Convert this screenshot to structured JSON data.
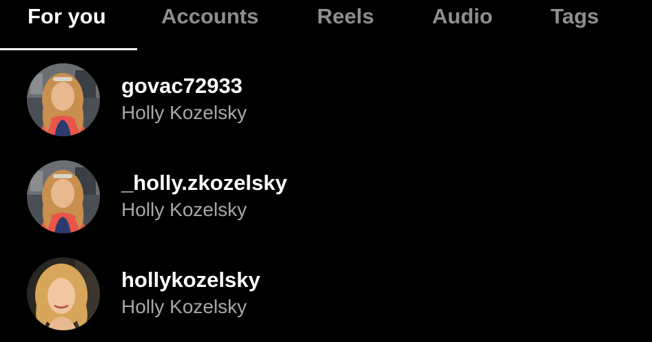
{
  "tabs": [
    {
      "label": "For you",
      "active": true
    },
    {
      "label": "Accounts",
      "active": false
    },
    {
      "label": "Reels",
      "active": false
    },
    {
      "label": "Audio",
      "active": false
    },
    {
      "label": "Tags",
      "active": false
    }
  ],
  "results": [
    {
      "username": "govac72933",
      "full_name": "Holly Kozelsky",
      "avatar": "profile-photo-woman-sunglasses"
    },
    {
      "username": "_holly.zkozelsky",
      "full_name": "Holly Kozelsky",
      "avatar": "profile-photo-woman-sunglasses"
    },
    {
      "username": "hollykozelsky",
      "full_name": "Holly Kozelsky",
      "avatar": "profile-photo-woman-portrait"
    }
  ],
  "colors": {
    "background": "#000000",
    "active_tab": "#ffffff",
    "inactive_tab": "#8e8e8e",
    "secondary_text": "#a8a8a8"
  }
}
